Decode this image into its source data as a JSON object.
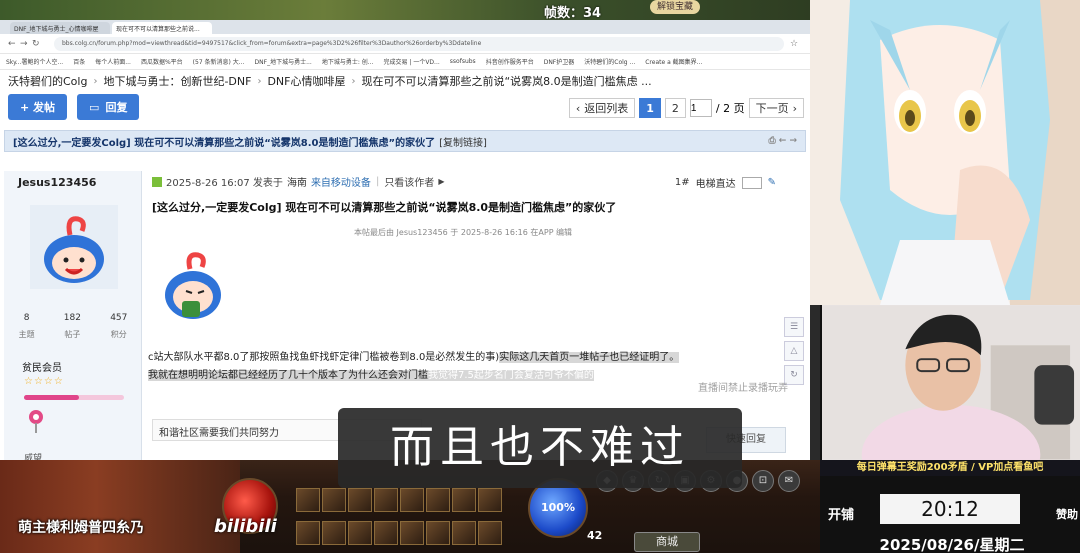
{
  "game": {
    "fps_label": "帧数：34",
    "top_chip": "解锁宝藏"
  },
  "browser": {
    "tabs": [
      {
        "label": "DNF_地下城与勇士_心情咖啡屋"
      },
      {
        "label": "现在可不可以清算那些之前说..."
      }
    ],
    "url": "bbs.colg.cn/forum.php?mod=viewthread&tid=9497517&click_from=forum&extra=page%3D2%26filter%3Dauthor%26orderby%3Ddateline",
    "bookmarks": [
      "Sky...署鲍的个人空...",
      "百条",
      "每个人前面...",
      "西瓜数据%平台",
      "(57 条新消息) 大...",
      "DNF_地下城与勇士...",
      "地下城与勇士: 创...",
      "完成交易 | 一个VD...",
      "ssofsubs",
      "抖音创作服务平台",
      "DNF护卫器",
      "沃特碧们的Colg ...",
      "Create a 截图集界..."
    ]
  },
  "breadcrumb": [
    "沃特碧们的Colg",
    "地下城与勇士：创新世纪-DNF",
    "DNF心情咖啡屋",
    "现在可不可以清算那些之前说“说雾岚8.0是制造门槛焦虑 ..."
  ],
  "actions": {
    "post_label": "+ 发帖",
    "reply_label": "回复"
  },
  "pager": {
    "back_label": "返回列表",
    "page1": "1",
    "page2": "2",
    "input_value": "1",
    "total": "/ 2 页",
    "next_label": "下一页"
  },
  "thread": {
    "title": "[这么过分,一定要发Colg] 现在可不可以清算那些之前说“说雾岚8.0是制造门槛焦虑”的家伙了",
    "copy_link": "[复制链接]"
  },
  "author": {
    "name": "Jesus123456",
    "stats": [
      {
        "value": "8",
        "label": "主题"
      },
      {
        "value": "182",
        "label": "帖子"
      },
      {
        "value": "457",
        "label": "积分"
      }
    ],
    "rank": "贫民会员",
    "stars": "☆☆☆☆",
    "more": "威望"
  },
  "post": {
    "meta_time": "2025-8-26 16:07 发表于",
    "meta_loc": "海南",
    "meta_dev": "来自移动设备",
    "meta_only": "只看该作者",
    "floor": "1#",
    "elevator": "电梯直达",
    "title": "[这么过分,一定要发Colg] 现在可不可以清算那些之前说“说雾岚8.0是制造门槛焦虑”的家伙了",
    "edit_note": "本帖最后由 Jesus123456 于 2025-8-26 16:16 在APP 编辑",
    "body_a": "c站大部队水平都8.0了那按照鱼找鱼虾找虾定律门槛被卷到8.0是必然发生的事)",
    "body_b": "实际这几天首页一堆帖子也已经证明了。",
    "body_c": "我就在想明明论坛都已经经历了几十个版本了为什么还会对门槛",
    "body_d": "我觉得7.5起步名门会复活可爷不偏的",
    "signature": "和谐社区需要我们共同努力",
    "reply_btn": "快速回复"
  },
  "watermark": "直播间禁止录播玩弄",
  "subtitle": "而且也不难过",
  "promo": "每日弹幕王奖励200矛盾 / VP加点看鱼吧",
  "hud": {
    "streamer": "萌主様利姆普四糸乃",
    "bili": "bilibili",
    "mp": "100%",
    "level": "42",
    "shop": "商城"
  },
  "clock": {
    "open": "开铺",
    "time": "20:12",
    "date": "2025/08/26/星期二",
    "reward": "赞助"
  }
}
